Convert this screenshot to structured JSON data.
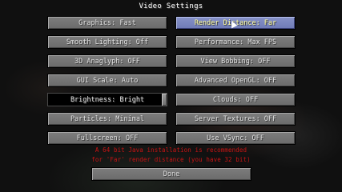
{
  "screen": {
    "title": "Video Settings"
  },
  "left": {
    "graphics": "Graphics: Fast",
    "smooth_lighting": "Smooth Lighting: Off",
    "anaglyph": "3D Anaglyph: OFF",
    "gui_scale": "GUI Scale: Auto",
    "brightness": "Brightness: Bright",
    "particles": "Particles: Minimal",
    "fullscreen": "Fullscreen: OFF"
  },
  "right": {
    "render_distance": "Render Distance: Far",
    "performance": "Performance: Max FPS",
    "view_bobbing": "View Bobbing: OFF",
    "advanced_opengl": "Advanced OpenGL: OFF",
    "clouds": "Clouds: OFF",
    "server_textures": "Server Textures: OFF",
    "vsync": "Use VSync: OFF"
  },
  "warning": {
    "line1": "A 64 bit Java installation is recommended",
    "line2": "for 'Far' render distance (you have 32 bit)"
  },
  "done_label": "Done",
  "brightness_level": 1.0
}
